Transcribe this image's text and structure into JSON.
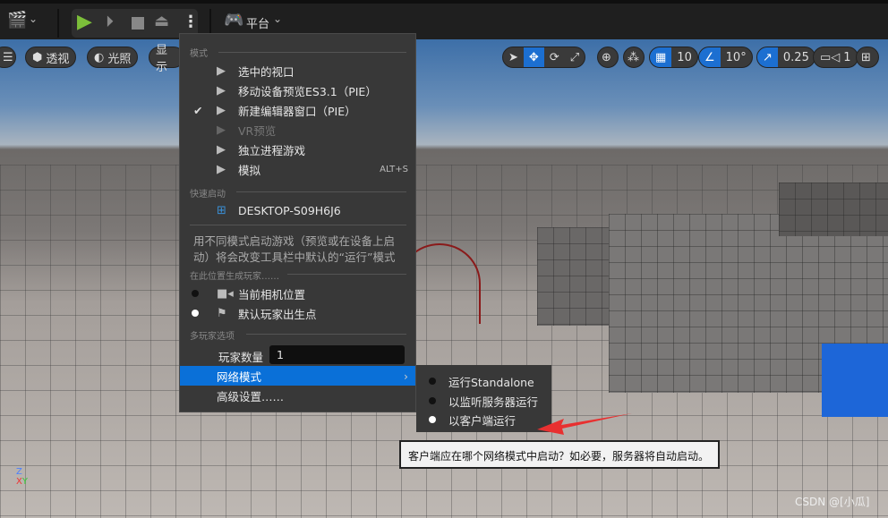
{
  "toolbar": {
    "platform_label": "平台",
    "icons": [
      "clapperboard-icon",
      "play-icon",
      "step-icon",
      "stop-icon",
      "eject-icon",
      "more-vertical-icon",
      "gamepad-monitor-icon"
    ]
  },
  "viewport_bar": {
    "perspective": "透视",
    "lighting": "光照",
    "show": "显示",
    "grid_snap": "10",
    "rotation_snap": "10°",
    "scale_snap": "0.25",
    "camera_speed": "1",
    "accent": "#1c6fd1"
  },
  "menu": {
    "mode_header": "模式",
    "modes": [
      {
        "label": "选中的视口",
        "checked": false,
        "disabled": false
      },
      {
        "label": "移动设备预览ES3.1（PIE）",
        "checked": false,
        "disabled": false
      },
      {
        "label": "新建编辑器窗口（PIE）",
        "checked": true,
        "disabled": false
      },
      {
        "label": "VR预览",
        "checked": false,
        "disabled": true
      },
      {
        "label": "独立进程游戏",
        "checked": false,
        "disabled": false
      },
      {
        "label": "模拟",
        "checked": false,
        "disabled": false,
        "shortcut": "ALT+S"
      }
    ],
    "quick_header": "快速启动",
    "device": "DESKTOP-S09H6J6",
    "hint": "用不同模式启动游戏（预览或在设备上启动）将会改变工具栏中默认的“运行”模式",
    "spawn_header": "在此位置生成玩家……",
    "spawn": [
      {
        "label": "当前相机位置",
        "selected": false
      },
      {
        "label": "默认玩家出生点",
        "selected": true
      }
    ],
    "multi_header": "多玩家选项",
    "player_count_label": "玩家数量",
    "player_count": "1",
    "net_mode": "网络模式",
    "advanced": "高级设置……"
  },
  "submenu": [
    {
      "label": "运行Standalone",
      "selected": false
    },
    {
      "label": "以监听服务器运行",
      "selected": false
    },
    {
      "label": "以客户端运行",
      "selected": true
    }
  ],
  "tooltip": "客户端应在哪个网络模式中启动？如必要，服务器将自动启动。",
  "watermark": "CSDN @[小瓜]"
}
